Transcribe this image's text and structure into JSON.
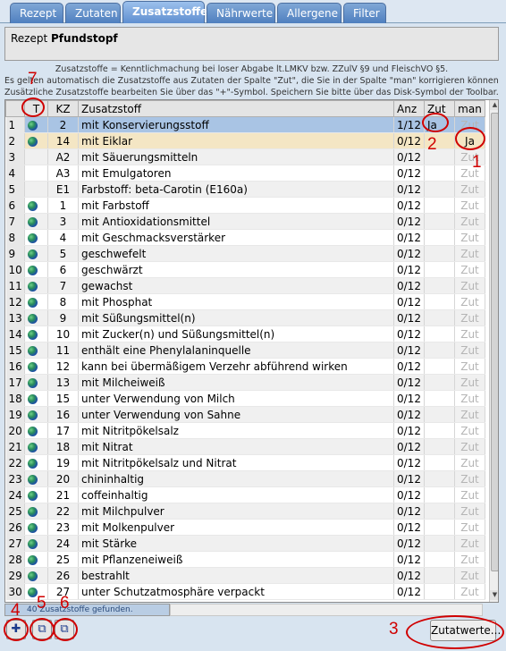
{
  "tabs": [
    {
      "label": "Rezept"
    },
    {
      "label": "Zutaten"
    },
    {
      "label": "Zusatzstoffe"
    },
    {
      "label": "Nährwerte"
    },
    {
      "label": "Allergene"
    },
    {
      "label": "Filter"
    }
  ],
  "recipe": {
    "label": "Rezept",
    "name": "Pfundstopf"
  },
  "info": {
    "line1": "Zusatzstoffe = Kenntlichmachung bei loser Abgabe lt.LMKV bzw. ZZulV §9 und FleischVO §5.",
    "line2": "Es gelten automatisch die Zusatzstoffe aus Zutaten der Spalte \"Zut\", die Sie in der Spalte \"man\" korrigieren können.",
    "line3": "Zusätzliche Zusatzstoffe bearbeiten Sie über das \"+\"-Symbol. Speichern Sie bitte über das Disk-Symbol der Toolbar."
  },
  "columns": {
    "t": "T",
    "kz": "KZ",
    "zusatzstoff": "Zusatzstoff",
    "anz": "Anz",
    "zut": "Zut",
    "man": "man"
  },
  "rows": [
    {
      "n": "1",
      "kz": "2",
      "name": "mit Konservierungsstoff",
      "anz": "1/12",
      "zut": "Ja",
      "man": "Zut",
      "globe": true
    },
    {
      "n": "2",
      "kz": "14",
      "name": "mit Eiklar",
      "anz": "0/12",
      "zut": "",
      "man": "Ja",
      "globe": true
    },
    {
      "n": "3",
      "kz": "A2",
      "name": "mit Säuerungsmitteln",
      "anz": "0/12",
      "zut": "",
      "man": "Zut",
      "globe": false
    },
    {
      "n": "4",
      "kz": "A3",
      "name": "mit Emulgatoren",
      "anz": "0/12",
      "zut": "",
      "man": "Zut",
      "globe": false
    },
    {
      "n": "5",
      "kz": "E1",
      "name": "Farbstoff: beta-Carotin (E160a)",
      "anz": "0/12",
      "zut": "",
      "man": "Zut",
      "globe": false
    },
    {
      "n": "6",
      "kz": "1",
      "name": "mit Farbstoff",
      "anz": "0/12",
      "zut": "",
      "man": "Zut",
      "globe": true
    },
    {
      "n": "7",
      "kz": "3",
      "name": "mit Antioxidationsmittel",
      "anz": "0/12",
      "zut": "",
      "man": "Zut",
      "globe": true
    },
    {
      "n": "8",
      "kz": "4",
      "name": "mit Geschmacksverstärker",
      "anz": "0/12",
      "zut": "",
      "man": "Zut",
      "globe": true
    },
    {
      "n": "9",
      "kz": "5",
      "name": "geschwefelt",
      "anz": "0/12",
      "zut": "",
      "man": "Zut",
      "globe": true
    },
    {
      "n": "10",
      "kz": "6",
      "name": "geschwärzt",
      "anz": "0/12",
      "zut": "",
      "man": "Zut",
      "globe": true
    },
    {
      "n": "11",
      "kz": "7",
      "name": "gewachst",
      "anz": "0/12",
      "zut": "",
      "man": "Zut",
      "globe": true
    },
    {
      "n": "12",
      "kz": "8",
      "name": "mit Phosphat",
      "anz": "0/12",
      "zut": "",
      "man": "Zut",
      "globe": true
    },
    {
      "n": "13",
      "kz": "9",
      "name": "mit Süßungsmittel(n)",
      "anz": "0/12",
      "zut": "",
      "man": "Zut",
      "globe": true
    },
    {
      "n": "14",
      "kz": "10",
      "name": "mit Zucker(n) und Süßungsmittel(n)",
      "anz": "0/12",
      "zut": "",
      "man": "Zut",
      "globe": true
    },
    {
      "n": "15",
      "kz": "11",
      "name": "enthält eine Phenylalaninquelle",
      "anz": "0/12",
      "zut": "",
      "man": "Zut",
      "globe": true
    },
    {
      "n": "16",
      "kz": "12",
      "name": "kann bei übermäßigem Verzehr abführend wirken",
      "anz": "0/12",
      "zut": "",
      "man": "Zut",
      "globe": true
    },
    {
      "n": "17",
      "kz": "13",
      "name": "mit Milcheiweiß",
      "anz": "0/12",
      "zut": "",
      "man": "Zut",
      "globe": true
    },
    {
      "n": "18",
      "kz": "15",
      "name": "unter Verwendung von Milch",
      "anz": "0/12",
      "zut": "",
      "man": "Zut",
      "globe": true
    },
    {
      "n": "19",
      "kz": "16",
      "name": "unter Verwendung von Sahne",
      "anz": "0/12",
      "zut": "",
      "man": "Zut",
      "globe": true
    },
    {
      "n": "20",
      "kz": "17",
      "name": "mit Nitritpökelsalz",
      "anz": "0/12",
      "zut": "",
      "man": "Zut",
      "globe": true
    },
    {
      "n": "21",
      "kz": "18",
      "name": "mit Nitrat",
      "anz": "0/12",
      "zut": "",
      "man": "Zut",
      "globe": true
    },
    {
      "n": "22",
      "kz": "19",
      "name": "mit Nitritpökelsalz und Nitrat",
      "anz": "0/12",
      "zut": "",
      "man": "Zut",
      "globe": true
    },
    {
      "n": "23",
      "kz": "20",
      "name": "chininhaltig",
      "anz": "0/12",
      "zut": "",
      "man": "Zut",
      "globe": true
    },
    {
      "n": "24",
      "kz": "21",
      "name": "coffeinhaltig",
      "anz": "0/12",
      "zut": "",
      "man": "Zut",
      "globe": true
    },
    {
      "n": "25",
      "kz": "22",
      "name": "mit Milchpulver",
      "anz": "0/12",
      "zut": "",
      "man": "Zut",
      "globe": true
    },
    {
      "n": "26",
      "kz": "23",
      "name": "mit Molkenpulver",
      "anz": "0/12",
      "zut": "",
      "man": "Zut",
      "globe": true
    },
    {
      "n": "27",
      "kz": "24",
      "name": "mit Stärke",
      "anz": "0/12",
      "zut": "",
      "man": "Zut",
      "globe": true
    },
    {
      "n": "28",
      "kz": "25",
      "name": "mit Pflanzeneiweiß",
      "anz": "0/12",
      "zut": "",
      "man": "Zut",
      "globe": true
    },
    {
      "n": "29",
      "kz": "26",
      "name": "bestrahlt",
      "anz": "0/12",
      "zut": "",
      "man": "Zut",
      "globe": true
    },
    {
      "n": "30",
      "kz": "27",
      "name": "unter Schutzatmosphäre verpackt",
      "anz": "0/12",
      "zut": "",
      "man": "Zut",
      "globe": true
    }
  ],
  "status": {
    "text": "40 Zusatzstoffe gefunden."
  },
  "buttons": {
    "zutatwerte": "Zutatwerte..."
  },
  "annotations": [
    "1",
    "2",
    "3",
    "4",
    "5",
    "6",
    "7"
  ],
  "colors": {
    "tab_active": "#5f8fd0",
    "selected_row": "#a9c4e4",
    "highlight_row": "#f4e6c4",
    "annotation": "#d00000"
  }
}
